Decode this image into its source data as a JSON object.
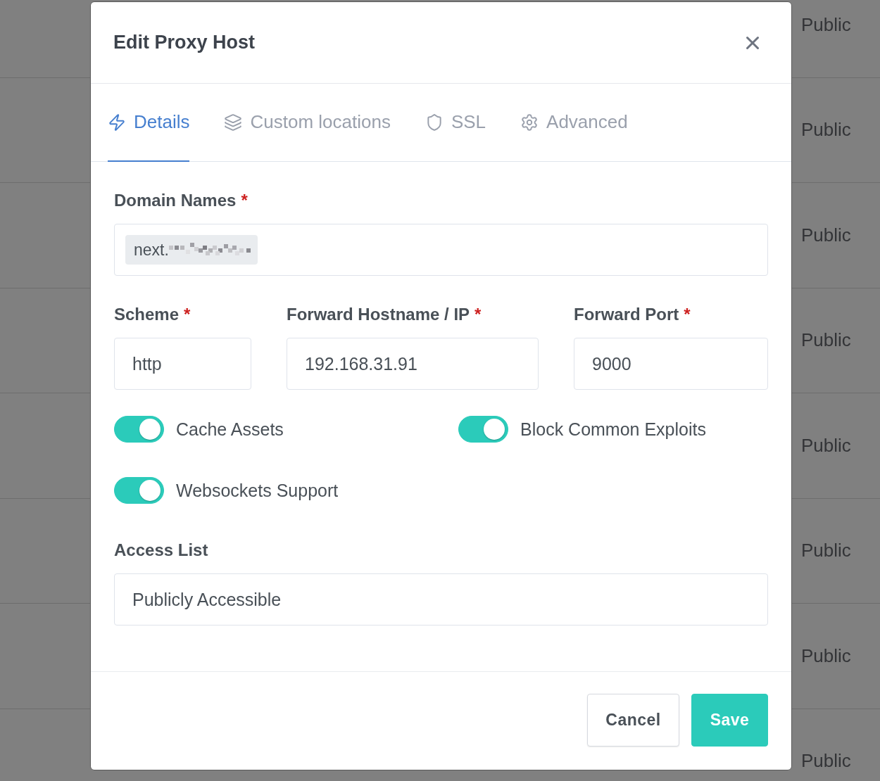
{
  "background_table": {
    "rows": [
      {
        "cell": "Public"
      },
      {
        "cell": "Public"
      },
      {
        "cell": "Public"
      },
      {
        "cell": "Public"
      },
      {
        "cell": "Public"
      },
      {
        "cell": "Public"
      },
      {
        "cell": "Public"
      },
      {
        "cell": "Public"
      }
    ]
  },
  "modal": {
    "title": "Edit Proxy Host",
    "tabs": [
      {
        "label": "Details",
        "selected": true
      },
      {
        "label": "Custom locations",
        "selected": false
      },
      {
        "label": "SSL",
        "selected": false
      },
      {
        "label": "Advanced",
        "selected": false
      }
    ],
    "domain_names": {
      "label": "Domain Names",
      "required_mark": "*",
      "chips": [
        {
          "text": "next.",
          "redacted": true
        }
      ]
    },
    "fields": [
      {
        "label": "Scheme",
        "required_mark": "*",
        "value": "http"
      },
      {
        "label": "Forward Hostname / IP",
        "required_mark": "*",
        "value": "192.168.31.91"
      },
      {
        "label": "Forward Port",
        "required_mark": "*",
        "value": "9000"
      }
    ],
    "toggles": [
      {
        "label": "Cache Assets",
        "on": true
      },
      {
        "label": "Block Common Exploits",
        "on": true
      },
      {
        "label": "Websockets Support",
        "on": true
      }
    ],
    "access_list": {
      "label": "Access List",
      "value": "Publicly Accessible"
    },
    "buttons": [
      {
        "label": "Cancel",
        "kind": "secondary"
      },
      {
        "label": "Save",
        "kind": "primary"
      }
    ]
  }
}
